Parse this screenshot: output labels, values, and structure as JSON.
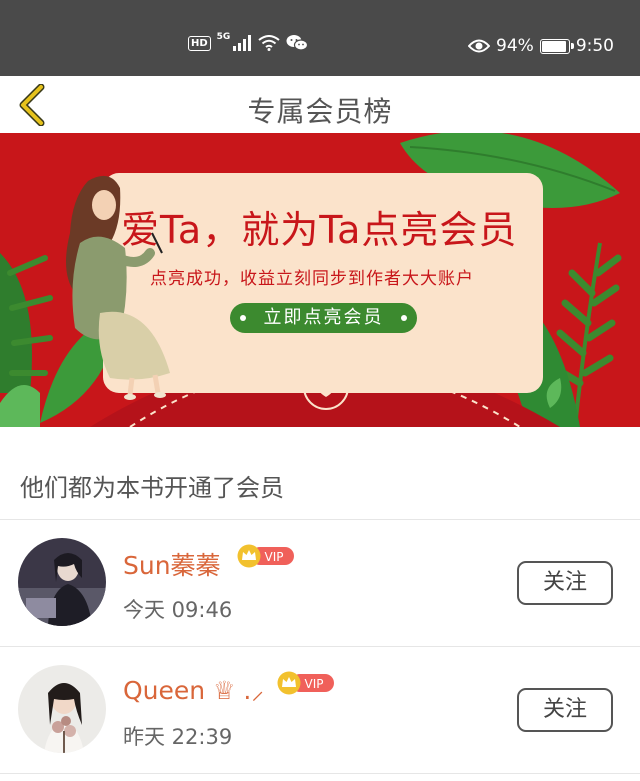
{
  "status_bar": {
    "network": "HD",
    "network_type": "5G",
    "battery_percent": "94%",
    "battery_level": 0.94,
    "time": "9:50",
    "icons": [
      "hd-icon",
      "signal-icon",
      "wifi-icon",
      "wechat-icon",
      "eye-icon",
      "battery-icon"
    ]
  },
  "header": {
    "title": "专属会员榜",
    "back_icon": "chevron-left-icon",
    "accent_color": "#e6c21b"
  },
  "banner": {
    "headline": "爱Ta，就为Ta点亮会员",
    "subtitle": "点亮成功，收益立刻同步到作者大大账户",
    "cta_label": "立即点亮会员",
    "colors": {
      "background": "#c8161a",
      "card": "#fbe3cb",
      "cta": "#3c8a2f"
    }
  },
  "section": {
    "title": "他们都为本书开通了会员"
  },
  "members": [
    {
      "name": "Sun蓁蓁",
      "badge": "VIP",
      "time": "今天 09:46",
      "follow_label": "关注"
    },
    {
      "name": "Queen ♕ .⸝",
      "badge": "VIP",
      "time": "昨天 22:39",
      "follow_label": "关注"
    }
  ],
  "colors": {
    "name_color": "#d9663a",
    "vip_badge": "#f0605a",
    "crown": "#f2c12e"
  }
}
